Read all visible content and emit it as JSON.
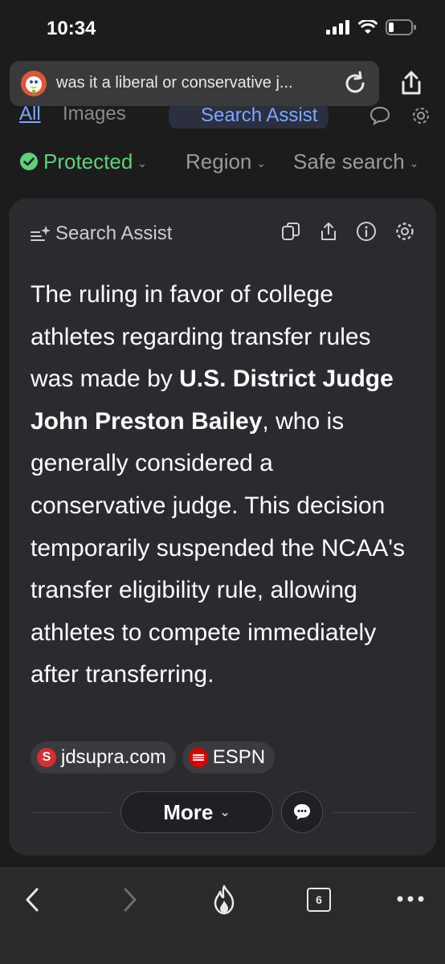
{
  "status": {
    "time": "10:34"
  },
  "url_bar": {
    "text": "was it a liberal or conservative j..."
  },
  "tabs": {
    "all": "All",
    "images": "Images",
    "search_assist": "Search Assist"
  },
  "filters": {
    "protected": "Protected",
    "region": "Region",
    "safe_search": "Safe search"
  },
  "card": {
    "title": "Search Assist",
    "body_part1": "The ruling in favor of college athletes regarding transfer rules was made by ",
    "body_bold": "U.S. District Judge John Preston Bailey",
    "body_part2": ", who is generally considered a conservative judge. This decision temporarily suspended the NCAA's transfer eligibility rule, allowing athletes to compete immediately after transferring.",
    "sources": [
      {
        "label": "jdsupra.com",
        "icon": "S"
      },
      {
        "label": "ESPN"
      }
    ],
    "more_label": "More"
  },
  "toolbar": {
    "tab_count": "6"
  },
  "colors": {
    "accent_green": "#5ed17a",
    "accent_blue": "#7ea7ff",
    "card_bg": "#2a2b2f"
  }
}
